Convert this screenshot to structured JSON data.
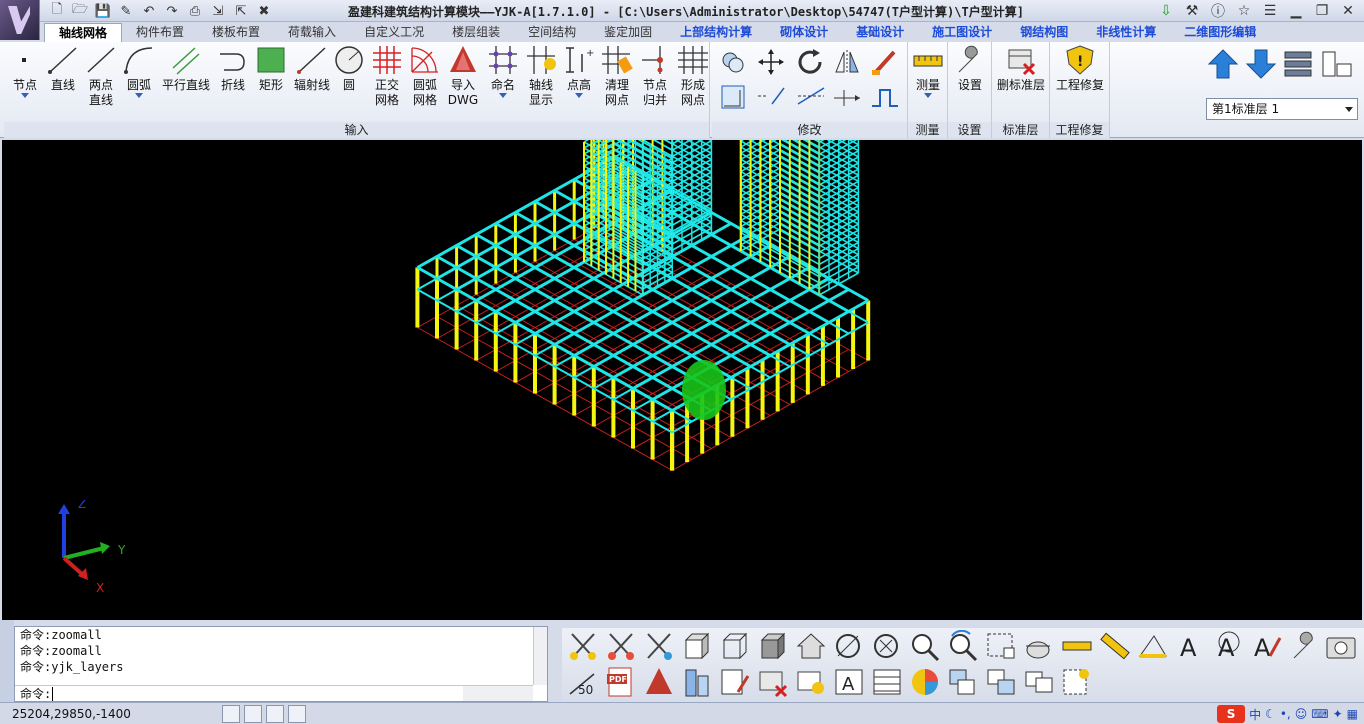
{
  "window": {
    "title": "盈建科建筑结构计算模块——YJK-A[1.7.1.0] - [C:\\Users\\Administrator\\Desktop\\54747(T户型计算)\\T户型计算]"
  },
  "tabs": [
    {
      "label": "轴线网格",
      "active": true
    },
    {
      "label": "构件布置"
    },
    {
      "label": "楼板布置"
    },
    {
      "label": "荷载输入"
    },
    {
      "label": "自定义工况"
    },
    {
      "label": "楼层组装"
    },
    {
      "label": "空间结构"
    },
    {
      "label": "鉴定加固"
    },
    {
      "label": "上部结构计算"
    },
    {
      "label": "砌体设计"
    },
    {
      "label": "基础设计"
    },
    {
      "label": "施工图设计"
    },
    {
      "label": "钢结构图"
    },
    {
      "label": "非线性计算"
    },
    {
      "label": "二维图形编辑"
    }
  ],
  "ribbon": {
    "input_buttons": [
      {
        "line1": "节点",
        "line2": ""
      },
      {
        "line1": "直线",
        "line2": ""
      },
      {
        "line1": "两点",
        "line2": "直线"
      },
      {
        "line1": "圆弧",
        "line2": ""
      },
      {
        "line1": "平行直线",
        "line2": ""
      },
      {
        "line1": "折线",
        "line2": ""
      },
      {
        "line1": "矩形",
        "line2": ""
      },
      {
        "line1": "辐射线",
        "line2": ""
      },
      {
        "line1": "圆",
        "line2": ""
      },
      {
        "line1": "正交",
        "line2": "网格"
      },
      {
        "line1": "圆弧",
        "line2": "网格"
      },
      {
        "line1": "导入",
        "line2": "DWG"
      },
      {
        "line1": "命名",
        "line2": ""
      },
      {
        "line1": "轴线",
        "line2": "显示"
      },
      {
        "line1": "点高",
        "line2": ""
      },
      {
        "line1": "清理",
        "line2": "网点"
      },
      {
        "line1": "节点",
        "line2": "归并"
      },
      {
        "line1": "形成",
        "line2": "网点"
      }
    ],
    "groups": {
      "input": "输入",
      "modify": "修改",
      "measure": "测量",
      "settings": "设置",
      "std_floor": "标准层",
      "repair": "工程修复"
    },
    "measure_btn": "测量",
    "settings_btn": "设置",
    "delete_floor_btn": "删标准层",
    "repair_btn": "工程修复",
    "floor_select": "第1标准层 1"
  },
  "viewport": {
    "axis_x": "X",
    "axis_y": "Y",
    "axis_z": "Z"
  },
  "command": {
    "history": [
      "命令:zoomall",
      "命令:zoomall",
      "命令:yjk_layers"
    ],
    "prompt": "命令:"
  },
  "status": {
    "coords": "25204,29850,-1400"
  },
  "ime": {
    "mode": "中"
  }
}
